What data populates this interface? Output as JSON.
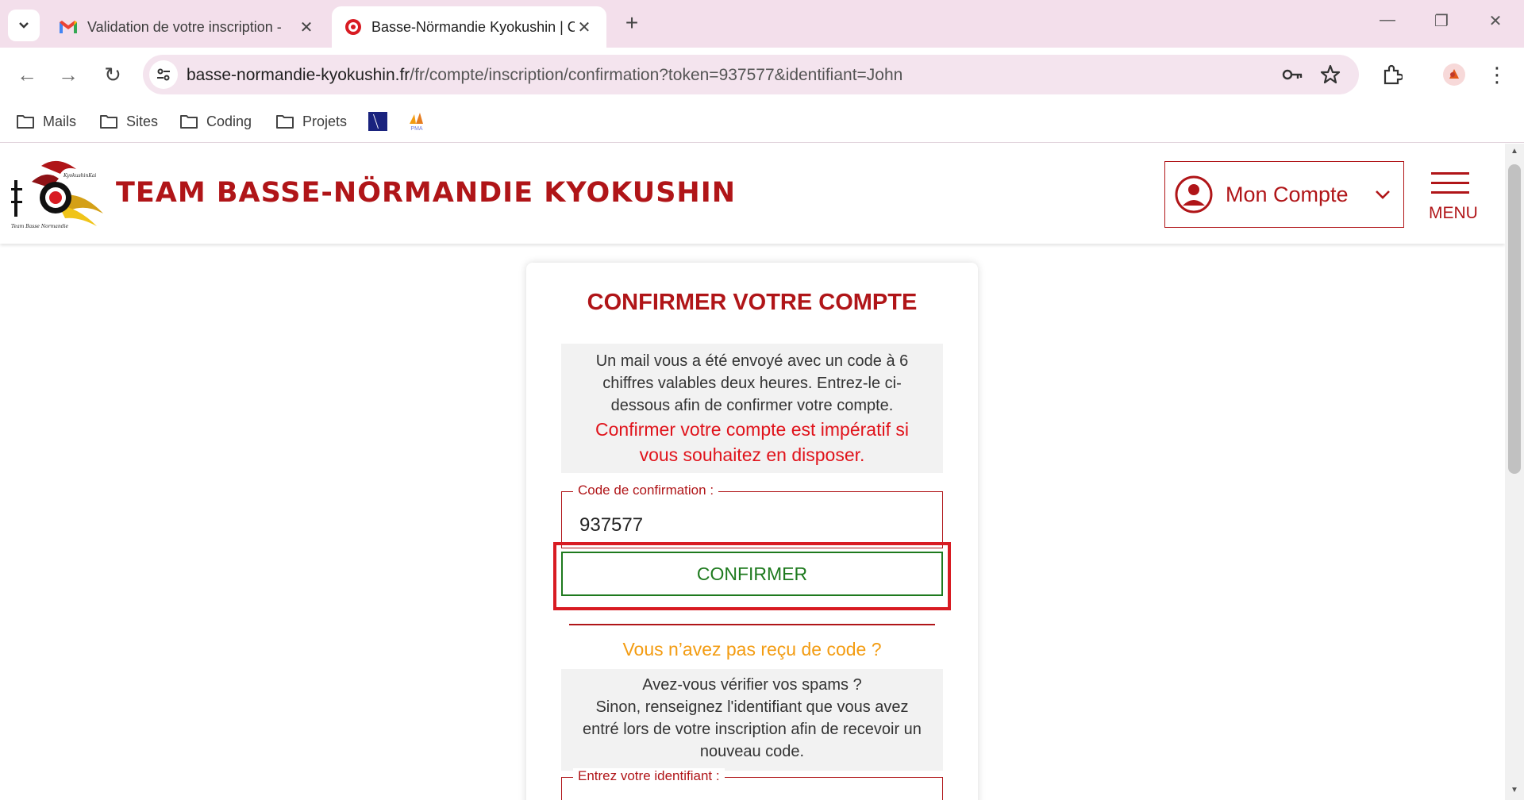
{
  "browser": {
    "tabs": [
      {
        "title": "Validation de votre inscription -",
        "icon": "gmail-icon"
      },
      {
        "title": "Basse-Nörmandie Kyokushin | C",
        "icon": "kyokushin-icon"
      }
    ],
    "url_host": "basse-normandie-kyokushin.fr",
    "url_path": "/fr/compte/inscription/confirmation?token=937577&identifiant=John",
    "bookmarks": [
      {
        "label": "Mails",
        "icon": "folder-icon"
      },
      {
        "label": "Sites",
        "icon": "folder-icon"
      },
      {
        "label": "Coding",
        "icon": "folder-icon"
      },
      {
        "label": "Projets",
        "icon": "folder-icon"
      }
    ],
    "bookmark_icons": [
      "vercel-like-icon",
      "pma-icon"
    ],
    "pma_label": "PMA"
  },
  "site": {
    "title": "TEAM BASSE-NÖRMANDIE KYOKUSHIN",
    "logo_top_text": "KyokushinKai",
    "logo_bottom_text": "Team Basse Normandie",
    "account_label": "Mon Compte",
    "menu_label": "MENU",
    "brand_color": "#b01518"
  },
  "card": {
    "title": "CONFIRMER VOTRE COMPTE",
    "info_text": "Un mail vous a été envoyé avec un code à 6 chiffres valables deux heures. Entrez-le ci-dessous afin de confirmer votre compte.",
    "info_warning": "Confirmer votre compte est impératif si vous souhaitez en disposer.",
    "code_legend": "Code de confirmation :",
    "code_value": "937577",
    "confirm_label": "CONFIRMER",
    "resend_title": "Vous n’avez pas reçu de code ?",
    "resend_line1": "Avez-vous vérifier vos spams ?",
    "resend_line2": "Sinon, renseignez l'identifiant que vous avez entré lors de votre inscription afin de recevoir un nouveau code.",
    "identifier_legend": "Entrez votre identifiant :"
  }
}
